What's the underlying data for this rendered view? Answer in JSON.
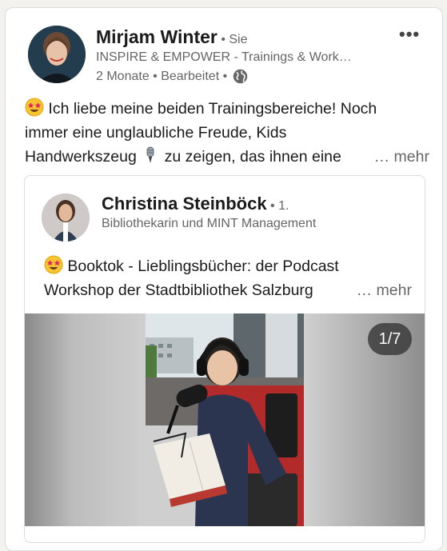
{
  "post": {
    "author_name": "Mirjam Winter",
    "author_relation": " • Sie",
    "author_headline": "INSPIRE & EMPOWER - Trainings & Work…",
    "meta_time": "2 Monate • Bearbeitet •",
    "text_line1": "Ich liebe meine beiden Trainingsbereiche! Noch",
    "text_line2": "immer eine unglaubliche Freude, Kids",
    "text_line3a": "Handwerkszeug",
    "text_line3b": "zu zeigen, das ihnen eine",
    "more_label": "… mehr",
    "menu_label": "•••"
  },
  "shared": {
    "author_name": "Christina Steinböck",
    "author_degree": " • 1.",
    "author_headline": "Bibliothekarin und MINT Management",
    "text_line1": "Booktok - Lieblingsbücher: der Podcast",
    "text_line2": "Workshop der Stadtbibliothek Salzburg",
    "more_label": "… mehr",
    "media_counter": "1/7"
  },
  "colors": {
    "name": "#1b1b1b",
    "secondary": "#666666",
    "border": "#dcdcdc"
  },
  "icons": [
    "star-struck-emoji-icon",
    "microphone-emoji-icon",
    "globe-icon"
  ]
}
